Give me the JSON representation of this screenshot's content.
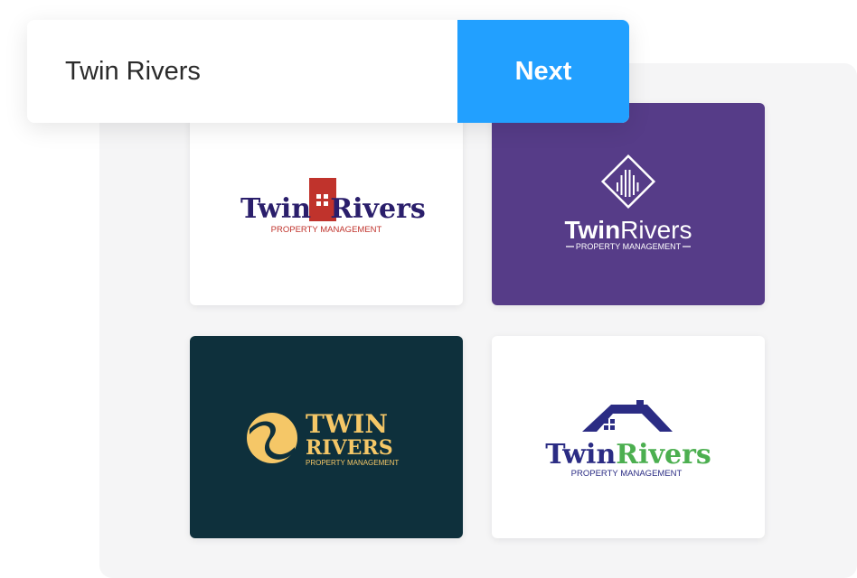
{
  "search": {
    "value": "Twin Rivers",
    "next_label": "Next"
  },
  "logos": [
    {
      "words": [
        "Twin",
        "Rivers"
      ],
      "tagline": "PROPERTY MANAGEMENT",
      "colors": {
        "background": "#ffffff",
        "text": "#2a1e6b",
        "accent": "#c0332c"
      },
      "icon": "building-icon"
    },
    {
      "words": [
        "Twin",
        "Rivers"
      ],
      "tagline": "PROPERTY MANAGEMENT",
      "colors": {
        "background": "#563c88",
        "text": "#ffffff"
      },
      "icon": "diamond-lines-icon"
    },
    {
      "words": [
        "TWIN",
        "RIVERS"
      ],
      "tagline": "PROPERTY MANAGEMENT",
      "colors": {
        "background": "#0e303c",
        "text": "#f5c767"
      },
      "icon": "swirl-icon"
    },
    {
      "words": [
        "Twin",
        "Rivers"
      ],
      "tagline": "PROPERTY MANAGEMENT",
      "colors": {
        "background": "#ffffff",
        "text": "#2b2c84",
        "accent": "#4caf50"
      },
      "icon": "house-roof-icon"
    }
  ]
}
